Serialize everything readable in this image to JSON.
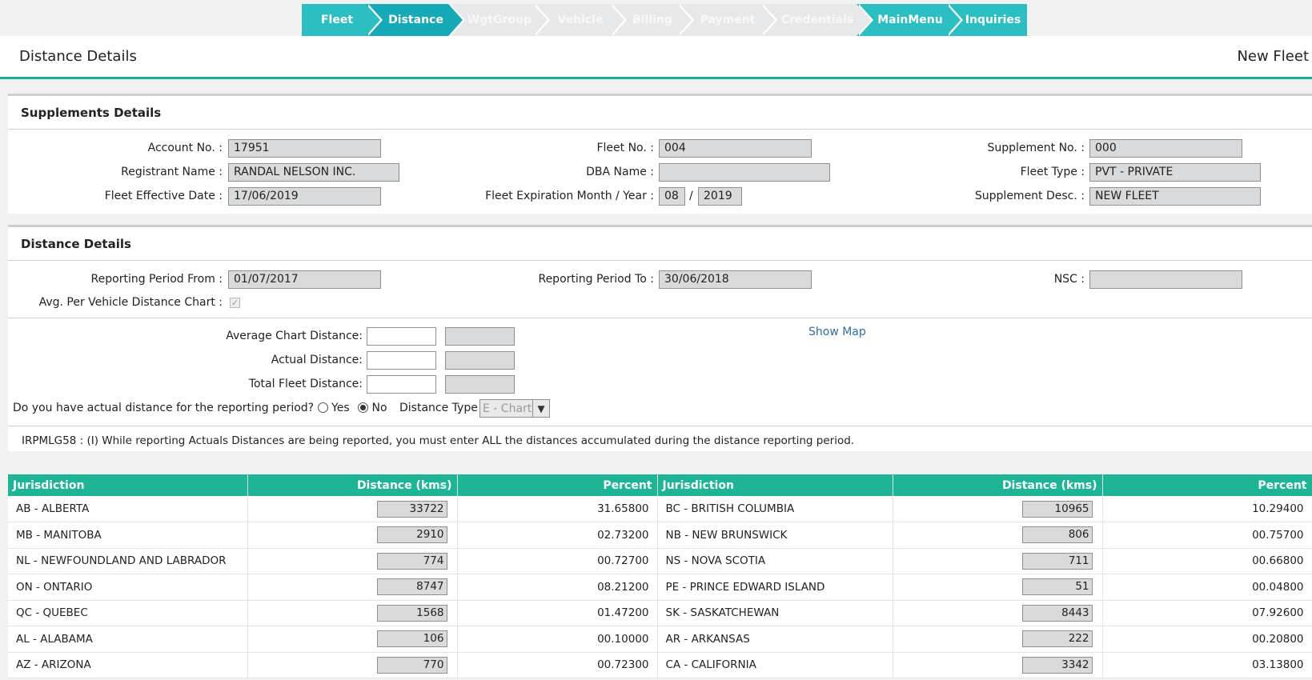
{
  "wizard": {
    "steps": [
      {
        "label": "Fleet",
        "state": "active"
      },
      {
        "label": "Distance",
        "state": "current"
      },
      {
        "label": "WgtGroup",
        "state": "disabled"
      },
      {
        "label": "Vehicle",
        "state": "disabled"
      },
      {
        "label": "Billing",
        "state": "disabled"
      },
      {
        "label": "Payment",
        "state": "disabled"
      },
      {
        "label": "Credentials",
        "state": "disabled"
      },
      {
        "label": "MainMenu",
        "state": "active"
      },
      {
        "label": "Inquiries",
        "state": "active"
      }
    ]
  },
  "header": {
    "title": "Distance Details",
    "mode": "New Fleet"
  },
  "supplements": {
    "heading": "Supplements Details",
    "account_no_label": "Account No. :",
    "account_no": "17951",
    "fleet_no_label": "Fleet No. :",
    "fleet_no": "004",
    "supplement_no_label": "Supplement No. :",
    "supplement_no": "000",
    "registrant_name_label": "Registrant Name :",
    "registrant_name": "RANDAL NELSON INC.",
    "dba_name_label": "DBA Name :",
    "dba_name": "",
    "fleet_type_label": "Fleet Type :",
    "fleet_type": "PVT - PRIVATE",
    "effective_date_label": "Fleet Effective Date :",
    "effective_date": "17/06/2019",
    "expiration_label": "Fleet Expiration Month / Year :",
    "expiration_month": "08",
    "expiration_sep": "/",
    "expiration_year": "2019",
    "supplement_desc_label": "Supplement Desc. :",
    "supplement_desc": "NEW FLEET"
  },
  "distance": {
    "heading": "Distance Details",
    "period_from_label": "Reporting Period From :",
    "period_from": "01/07/2017",
    "period_to_label": "Reporting Period To :",
    "period_to": "30/06/2018",
    "nsc_label": "NSC :",
    "nsc": "",
    "avg_chart_label": "Avg. Per Vehicle Distance Chart :",
    "avg_chart_checked": "✓",
    "average_chart_distance_label": "Average Chart Distance:",
    "actual_distance_label": "Actual Distance:",
    "total_fleet_distance_label": "Total Fleet Distance:",
    "show_map": "Show Map",
    "actual_question": "Do you have actual distance for the reporting period?",
    "yes_label": "Yes",
    "no_label": "No",
    "distance_type_label": "Distance Type",
    "distance_type": "E - Chart",
    "message": "IRPMLG58 : (I) While reporting Actuals Distances are being reported, you must enter ALL the distances accumulated during the distance reporting period."
  },
  "table": {
    "headers": [
      "Jurisdiction",
      "Distance (kms)",
      "Percent",
      "Jurisdiction",
      "Distance (kms)",
      "Percent"
    ],
    "rows": [
      [
        "AB - ALBERTA",
        "33722",
        "31.65800",
        "BC - BRITISH COLUMBIA",
        "10965",
        "10.29400"
      ],
      [
        "MB - MANITOBA",
        "2910",
        "02.73200",
        "NB - NEW BRUNSWICK",
        "806",
        "00.75700"
      ],
      [
        "NL - NEWFOUNDLAND AND LABRADOR",
        "774",
        "00.72700",
        "NS - NOVA SCOTIA",
        "711",
        "00.66800"
      ],
      [
        "ON - ONTARIO",
        "8747",
        "08.21200",
        "PE - PRINCE EDWARD ISLAND",
        "51",
        "00.04800"
      ],
      [
        "QC - QUEBEC",
        "1568",
        "01.47200",
        "SK - SASKATCHEWAN",
        "8443",
        "07.92600"
      ],
      [
        "AL - ALABAMA",
        "106",
        "00.10000",
        "AR - ARKANSAS",
        "222",
        "00.20800"
      ],
      [
        "AZ - ARIZONA",
        "770",
        "00.72300",
        "CA - CALIFORNIA",
        "3342",
        "03.13800"
      ]
    ]
  },
  "colors": {
    "accent": "#1eb596",
    "wizard_active": "#2bbfc3",
    "wizard_current": "#16a9b7",
    "wizard_disabled": "#e6e8ea",
    "link": "#2f6f9f"
  }
}
